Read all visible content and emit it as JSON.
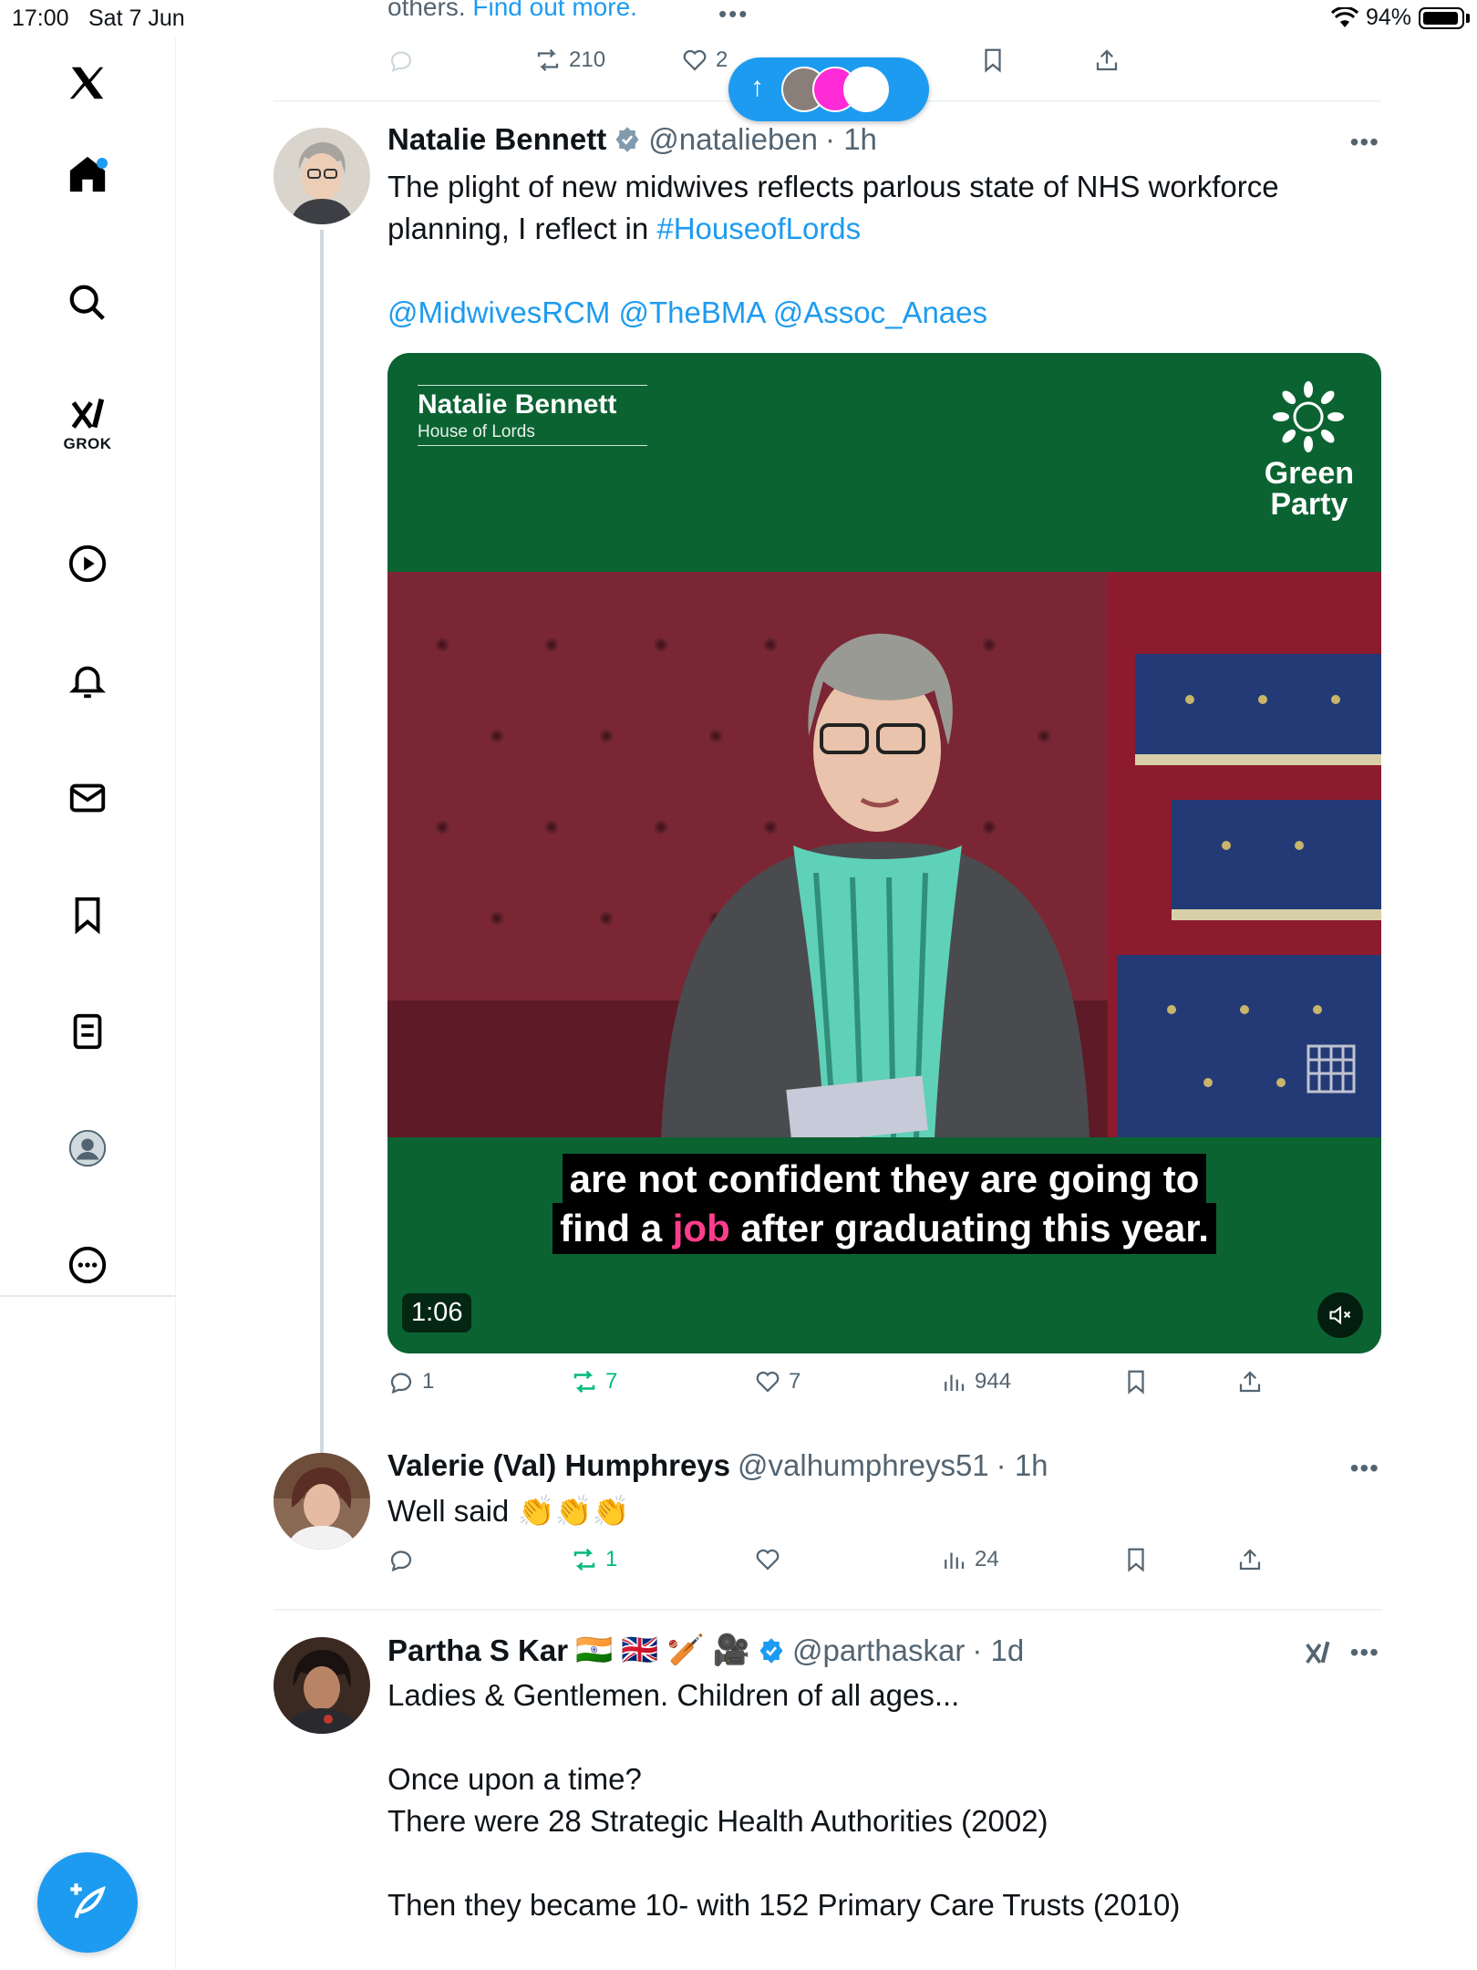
{
  "status_bar": {
    "time": "17:00",
    "date": "Sat 7 Jun",
    "battery": "94%",
    "battery_level": 0.94
  },
  "sidebar": {
    "grok_label": "GROK",
    "icons": [
      "x-logo-icon",
      "home-icon",
      "search-icon",
      "grok-icon",
      "video-icon",
      "bell-icon",
      "mail-icon",
      "bookmark-icon",
      "list-icon",
      "profile-icon",
      "more-icon"
    ]
  },
  "top_tweet": {
    "partial_text": "others.",
    "partial_link": "Find out more.",
    "retweets": "210",
    "likes": "2"
  },
  "tweet1": {
    "name": "Natalie Bennett",
    "handle": "@natalieben",
    "time": "· 1h",
    "text_main": "The plight of new midwives reflects parlous state of NHS workforce planning, I reflect in",
    "hashtag": "#HouseofLords",
    "mentions": "@MidwivesRCM @TheBMA @Assoc_Anaes",
    "video": {
      "name_title": "Natalie Bennett",
      "name_subtitle": "House of Lords",
      "logo_line1": "Green",
      "logo_line2": "Party",
      "caption_line1": "are not confident they are going to",
      "caption_line2_a": "find a",
      "caption_line2_hl": "job",
      "caption_line2_b": "after graduating this year.",
      "duration": "1:06"
    },
    "replies": "1",
    "retweets": "7",
    "likes": "7",
    "views": "944"
  },
  "tweet2": {
    "name": "Valerie (Val) Humphreys",
    "handle": "@valhumphreys51",
    "time": "· 1h",
    "text": "Well said 👏👏👏",
    "retweets": "1",
    "views": "24"
  },
  "tweet3": {
    "name": "Partha S Kar",
    "emojis": "🇮🇳 🇬🇧 🏏 🎥",
    "handle": "@parthaskar",
    "time": "· 1d",
    "line1": "Ladies & Gentlemen. Children of all ages...",
    "line2": "Once upon a time?",
    "line3": "There were 28 Strategic Health Authorities (2002)",
    "line4": "Then they became 10- with 152 Primary Care Trusts (2010)"
  },
  "colors": {
    "accent": "#1d9bf0",
    "repost_green": "#00ba7c",
    "video_green": "#0b6332",
    "muted": "#536471"
  }
}
